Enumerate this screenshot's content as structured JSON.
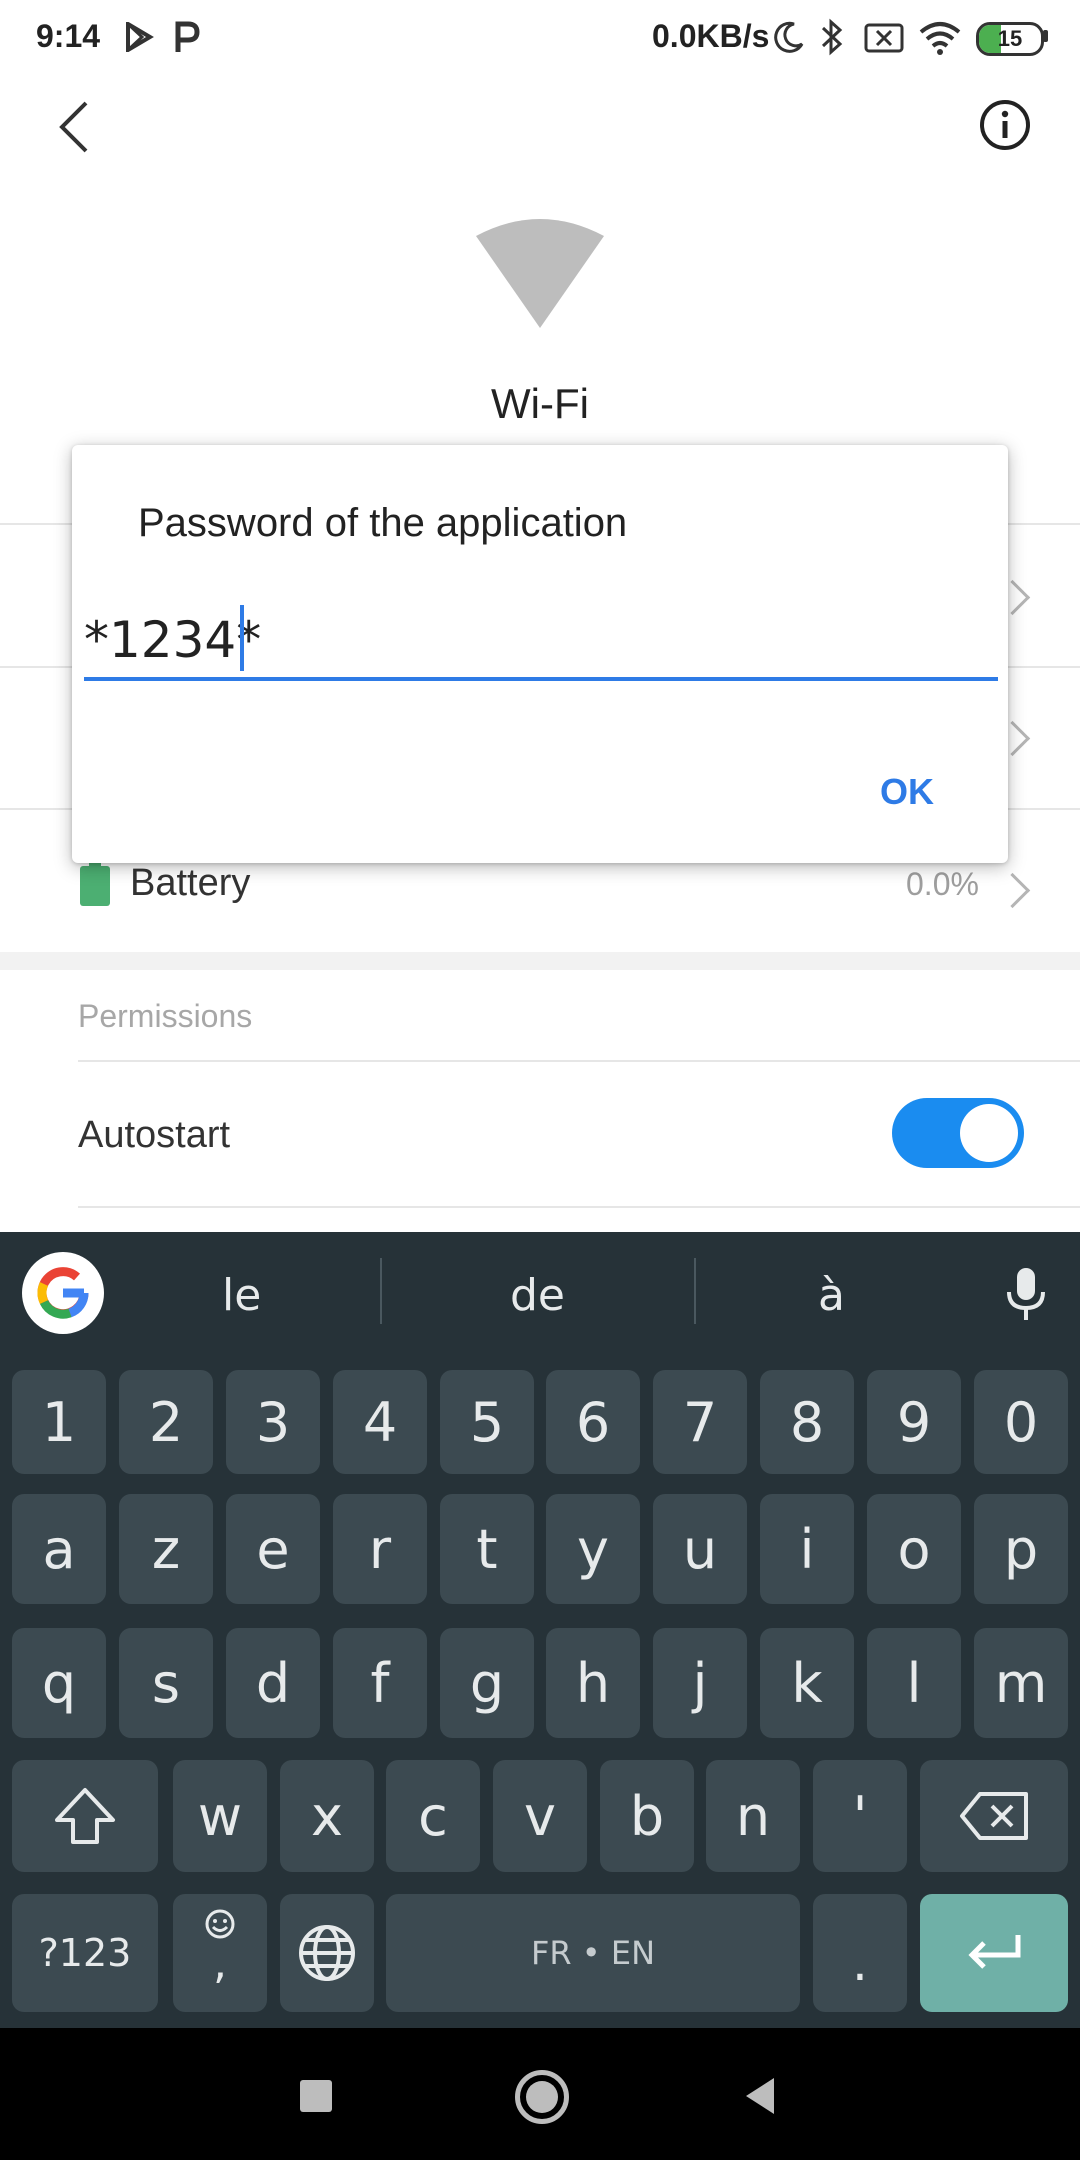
{
  "status_bar": {
    "time": "9:14",
    "net_speed": "0.0KB/s",
    "battery": "15"
  },
  "header": {
    "device_title": "Wi-Fi"
  },
  "rows": {
    "battery_label": "Battery",
    "battery_value": "0.0%"
  },
  "permissions": {
    "section_label": "Permissions",
    "autostart_label": "Autostart",
    "autostart_on": true
  },
  "dialog": {
    "title": "Password of the application",
    "input_value": "*1234*",
    "ok_label": "OK"
  },
  "keyboard": {
    "suggestions": [
      "le",
      "de",
      "à"
    ],
    "row_numbers": [
      "1",
      "2",
      "3",
      "4",
      "5",
      "6",
      "7",
      "8",
      "9",
      "0"
    ],
    "row1": [
      "a",
      "z",
      "e",
      "r",
      "t",
      "y",
      "u",
      "i",
      "o",
      "p"
    ],
    "row2": [
      "q",
      "s",
      "d",
      "f",
      "g",
      "h",
      "j",
      "k",
      "l",
      "m"
    ],
    "row3": [
      "w",
      "x",
      "c",
      "v",
      "b",
      "n",
      "'"
    ],
    "symbols_label": "?123",
    "comma_label": ",",
    "space_label": "FR • EN",
    "period_label": "."
  },
  "colors": {
    "accent": "#2e7be6",
    "toggle": "#1a8cf0",
    "enter_key": "#6fb0a7",
    "battery_icon": "#4caf72"
  }
}
